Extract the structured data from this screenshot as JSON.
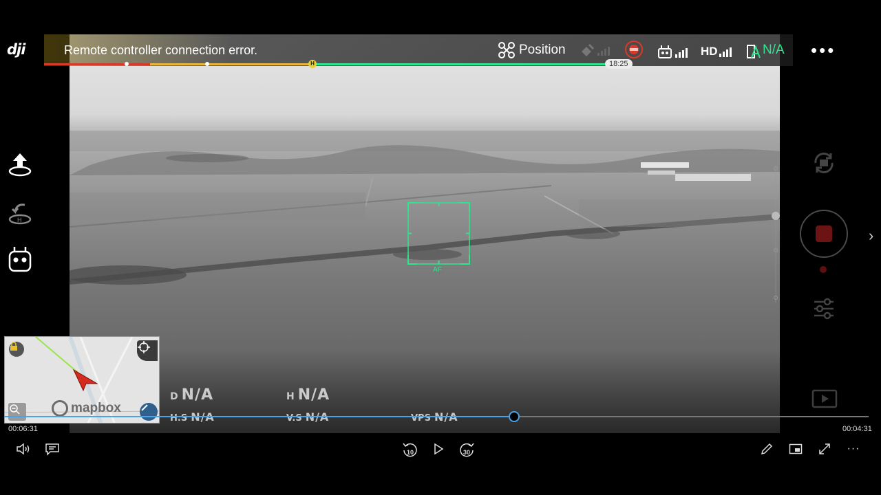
{
  "app": {
    "logo_text": "dji"
  },
  "status": {
    "alert": "Remote controller connection error.",
    "flight_mode": "Position",
    "battery_text": "N/A",
    "battery_time": "18:25",
    "hd_label": "HD"
  },
  "camera": {
    "focus_label": "AF"
  },
  "telemetry": {
    "distance": {
      "label": "D",
      "value": "N/A"
    },
    "height": {
      "label": "H",
      "value": "N/A"
    },
    "h_speed": {
      "label": "H.S",
      "value": "N/A"
    },
    "v_speed": {
      "label": "V.S",
      "value": "N/A"
    },
    "vps": {
      "label": "VPS",
      "value": "N/A"
    }
  },
  "map": {
    "brand": "mapbox"
  },
  "player": {
    "current_time": "00:06:31",
    "remaining_time": "00:04:31",
    "progress": 0.59,
    "rewind_seconds": "10",
    "forward_seconds": "30"
  },
  "colors": {
    "accent_green": "#2ee58e",
    "battery_red": "#d83a2a",
    "battery_yellow": "#e8b53a",
    "progress_blue": "#4aa3e8"
  },
  "icons": [
    "takeoff-icon",
    "return-home-icon",
    "controller-icon",
    "drone-icon",
    "gps-icon",
    "obstacle-sensing-icon",
    "rc-signal-icon",
    "hd-signal-icon",
    "battery-icon",
    "more-icon",
    "camera-switch-icon",
    "shutter-icon",
    "settings-sliders-icon",
    "playback-icon",
    "chevron-right-icon",
    "volume-icon",
    "subtitles-icon",
    "rewind-10-icon",
    "play-icon",
    "forward-30-icon",
    "edit-icon",
    "miniplayer-icon",
    "fullscreen-icon",
    "player-more-icon"
  ]
}
